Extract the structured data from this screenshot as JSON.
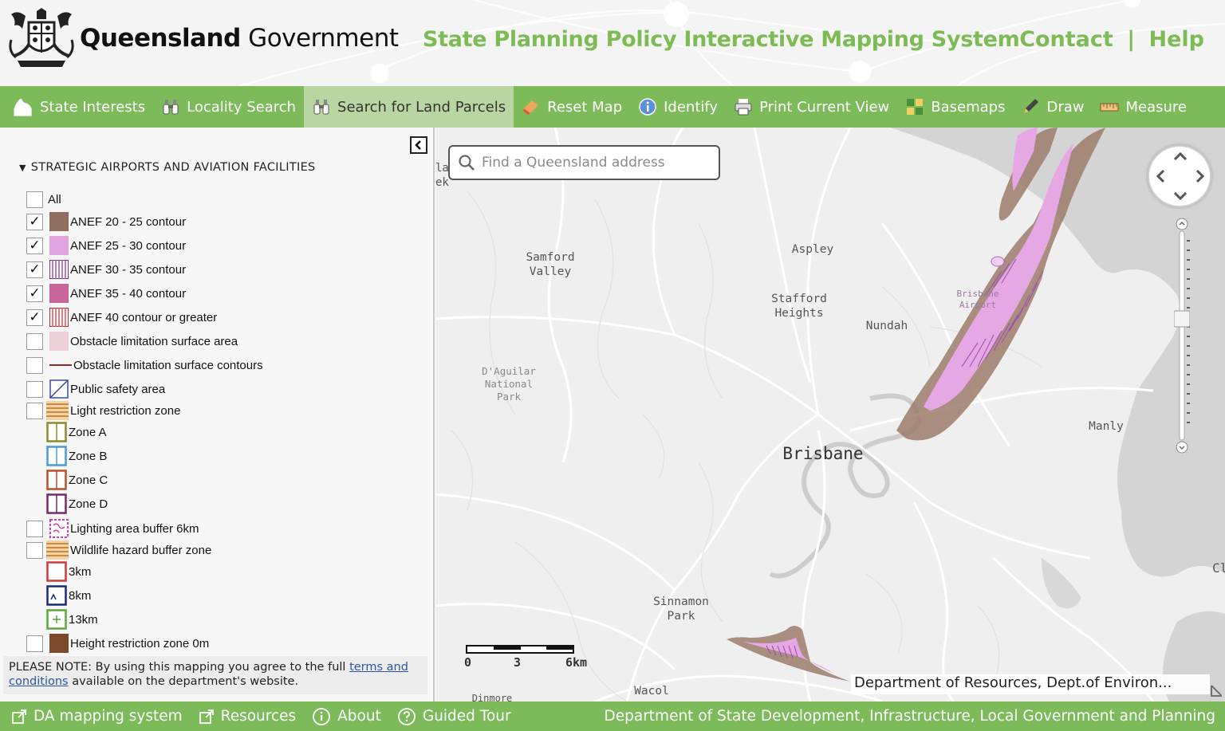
{
  "header": {
    "brand_bold": "Queensland",
    "brand_light": "Government",
    "system_title": "State Planning Policy Interactive Mapping System",
    "contact": "Contact",
    "separator": "|",
    "help": "Help"
  },
  "toolbar": {
    "items": [
      {
        "label": "State Interests",
        "icon": "hand-icon"
      },
      {
        "label": "Locality Search",
        "icon": "binoculars-icon"
      },
      {
        "label": "Search for Land Parcels",
        "icon": "binoculars-icon",
        "active": true
      },
      {
        "label": "Reset Map",
        "icon": "eraser-icon"
      },
      {
        "label": "Identify",
        "icon": "info-icon"
      },
      {
        "label": "Print Current View",
        "icon": "printer-icon"
      },
      {
        "label": "Basemaps",
        "icon": "basemaps-icon"
      },
      {
        "label": "Draw",
        "icon": "pen-icon"
      },
      {
        "label": "Measure",
        "icon": "ruler-icon"
      }
    ]
  },
  "panel": {
    "section_title": "STRATEGIC AIRPORTS AND AVIATION FACILITIES",
    "layers": [
      {
        "label": "All",
        "checked": false
      },
      {
        "label": "ANEF 20 - 25 contour",
        "checked": true
      },
      {
        "label": "ANEF 25 - 30 contour",
        "checked": true
      },
      {
        "label": "ANEF 30 - 35 contour",
        "checked": true
      },
      {
        "label": "ANEF 35 - 40 contour",
        "checked": true
      },
      {
        "label": "ANEF 40 contour or greater",
        "checked": true
      },
      {
        "label": "Obstacle limitation surface area",
        "checked": false
      },
      {
        "label": "Obstacle limitation surface contours",
        "checked": false
      },
      {
        "label": "Public safety area",
        "checked": false
      },
      {
        "label": "Light restriction zone",
        "checked": false
      },
      {
        "label": "Zone A"
      },
      {
        "label": "Zone B"
      },
      {
        "label": "Zone C"
      },
      {
        "label": "Zone D"
      },
      {
        "label": "Lighting area buffer 6km",
        "checked": false
      },
      {
        "label": "Wildlife hazard buffer zone",
        "checked": false
      },
      {
        "label": "3km"
      },
      {
        "label": "8km"
      },
      {
        "label": "13km"
      },
      {
        "label": "Height restriction zone 0m",
        "checked": false
      }
    ],
    "checkmark": "✓",
    "note_prefix": "PLEASE NOTE: By using this mapping you agree to the full ",
    "note_link": "terms and conditions",
    "note_suffix": " available on the department's website."
  },
  "map": {
    "search_placeholder": "Find a Queensland address",
    "labels": {
      "samford": "Samford\nValley",
      "aspley": "Aspley",
      "stafford": "Stafford\nHeights",
      "nundah": "Nundah",
      "daguilar": "D'Aguilar\nNational\nPark",
      "brisbane": "Brisbane",
      "airport": "Brisbane\nAirport",
      "manly": "Manly",
      "sinnamon": "Sinnamon\nPark",
      "wacol": "Wacol",
      "dinmore": "Dinmore",
      "edge_left": "lar\nek",
      "edge_right": "Cl"
    },
    "scale": {
      "zero": "0",
      "mid": "3",
      "end": "6km"
    },
    "attribution": "Department of Resources, Dept.of Environ..."
  },
  "footer": {
    "items": [
      {
        "label": "DA mapping system",
        "icon": "external-link-icon"
      },
      {
        "label": "Resources",
        "icon": "external-link-icon"
      },
      {
        "label": "About",
        "icon": "info-circle-icon"
      },
      {
        "label": "Guided Tour",
        "icon": "question-circle-icon"
      }
    ],
    "department": "Department of State Development, Infrastructure, Local Government and Planning"
  },
  "colors": {
    "green": "#7cba5a",
    "title_green": "#7dbb55",
    "anef_20_25": "#8e6e5e",
    "anef_25_30": "#e0a4e0",
    "anef_35_40": "#c8659a"
  }
}
